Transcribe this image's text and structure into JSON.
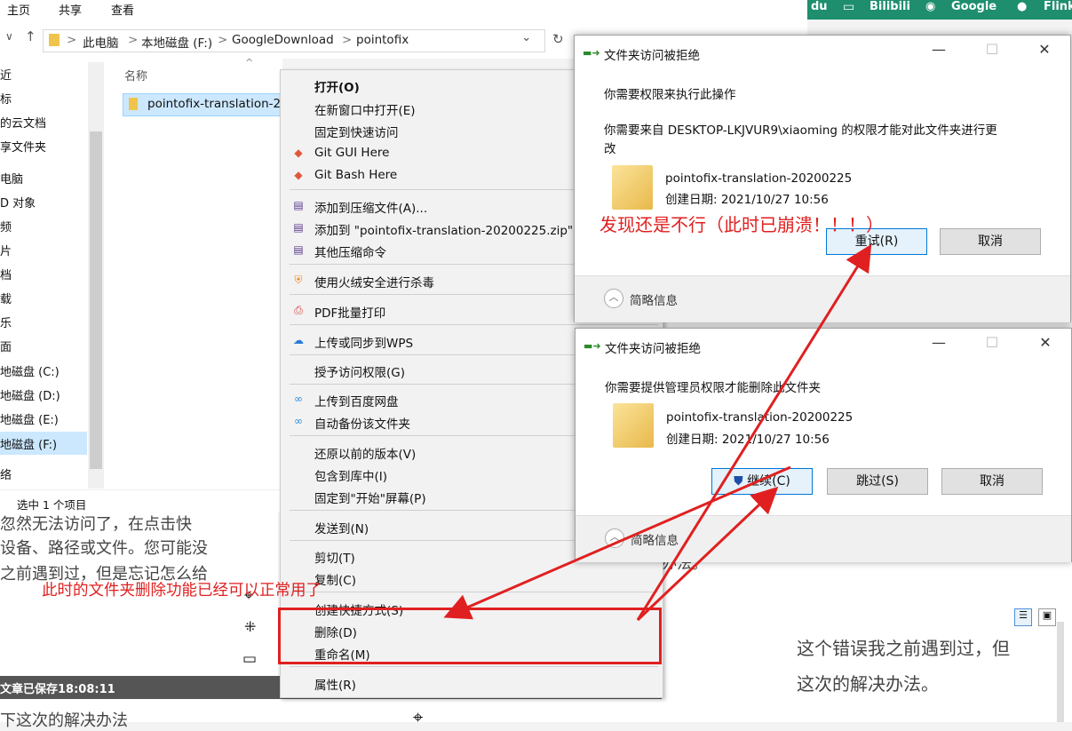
{
  "ribbon": {
    "tabs": [
      "主页",
      "共享",
      "查看"
    ]
  },
  "browser_bar": {
    "items": [
      "du",
      "Bilibili",
      "Google",
      "Flink"
    ]
  },
  "address": {
    "breadcrumbs": [
      "此电脑",
      "本地磁盘 (F:)",
      "GoogleDownload",
      "pointofix"
    ],
    "sep": ">",
    "chevron": "⌄",
    "refresh": "↻"
  },
  "nav": {
    "items": [
      "近",
      "标",
      "的云文档",
      "享文件夹",
      "电脑",
      "D 对象",
      "频",
      "片",
      "档",
      "载",
      "乐",
      "面",
      "地磁盘 (C:)",
      "地磁盘 (D:)",
      "地磁盘 (E:)",
      "地磁盘 (F:)",
      "络"
    ]
  },
  "filelist": {
    "column_name": "名称",
    "selected_file": "pointofix-translation-2"
  },
  "statusbar": {
    "selection": "选中 1 个项目"
  },
  "article": {
    "lines": [
      "忽然无法访问了，在点击快",
      "设备、路径或文件。您可能没",
      "之前遇到过，但是忘记怎么给"
    ],
    "saved": "文章已保存18:08:11",
    "bottom": "下这次的解决办法",
    "right_lines": [
      "这个错误我之前遇到过，但",
      "这次的解决办法。"
    ],
    "right_fragment": "办法。"
  },
  "context_menu": {
    "items": [
      {
        "label": "打开(O)",
        "icon": ""
      },
      {
        "label": "在新窗口中打开(E)",
        "icon": ""
      },
      {
        "label": "固定到快速访问",
        "icon": ""
      },
      {
        "label": "Git GUI Here",
        "icon": "git-icon"
      },
      {
        "label": "Git Bash Here",
        "icon": "git-icon"
      },
      {
        "label": "添加到压缩文件(A)...",
        "icon": "archive-icon"
      },
      {
        "label": "添加到 \"pointofix-translation-20200225.zip\" (",
        "icon": "archive-icon"
      },
      {
        "label": "其他压缩命令",
        "icon": "archive-icon"
      },
      {
        "label": "使用火绒安全进行杀毒",
        "icon": "shield-flame-icon"
      },
      {
        "label": "PDF批量打印",
        "icon": "printer-icon"
      },
      {
        "label": "上传或同步到WPS",
        "icon": "cloud-upload-icon"
      },
      {
        "label": "授予访问权限(G)",
        "icon": ""
      },
      {
        "label": "上传到百度网盘",
        "icon": "baidu-cloud-icon"
      },
      {
        "label": "自动备份该文件夹",
        "icon": "baidu-cloud-icon"
      },
      {
        "label": "还原以前的版本(V)",
        "icon": ""
      },
      {
        "label": "包含到库中(I)",
        "icon": ""
      },
      {
        "label": "固定到\"开始\"屏幕(P)",
        "icon": ""
      },
      {
        "label": "发送到(N)",
        "icon": ""
      },
      {
        "label": "剪切(T)",
        "icon": ""
      },
      {
        "label": "复制(C)",
        "icon": ""
      },
      {
        "label": "创建快捷方式(S)",
        "icon": ""
      },
      {
        "label": "删除(D)",
        "icon": ""
      },
      {
        "label": "重命名(M)",
        "icon": ""
      },
      {
        "label": "属性(R)",
        "icon": ""
      }
    ]
  },
  "dialog1": {
    "title": "文件夹访问被拒绝",
    "heading": "你需要权限来执行此操作",
    "message_line1": "你需要来自 DESKTOP-LKJVUR9\\xiaoming 的权限才能对此文件夹进行更",
    "message_line2": "改",
    "folder_name": "pointofix-translation-20200225",
    "created": "创建日期: 2021/10/27 10:56",
    "retry": "重试(R)",
    "cancel": "取消",
    "details": "简略信息"
  },
  "dialog2": {
    "title": "文件夹访问被拒绝",
    "heading": "你需要提供管理员权限才能删除此文件夹",
    "folder_name": "pointofix-translation-20200225",
    "created": "创建日期: 2021/10/27 10:56",
    "continue": "继续(C)",
    "skip": "跳过(S)",
    "cancel": "取消",
    "details": "简略信息"
  },
  "annotations": {
    "red_top": "发现还是不行（此时已崩溃！！！）",
    "red_mid": "此时的文件夹删除功能已经可以正常用了"
  },
  "colors": {
    "accent": "#0078d7",
    "annotation_red": "#e02020",
    "selection": "#cce8ff"
  }
}
